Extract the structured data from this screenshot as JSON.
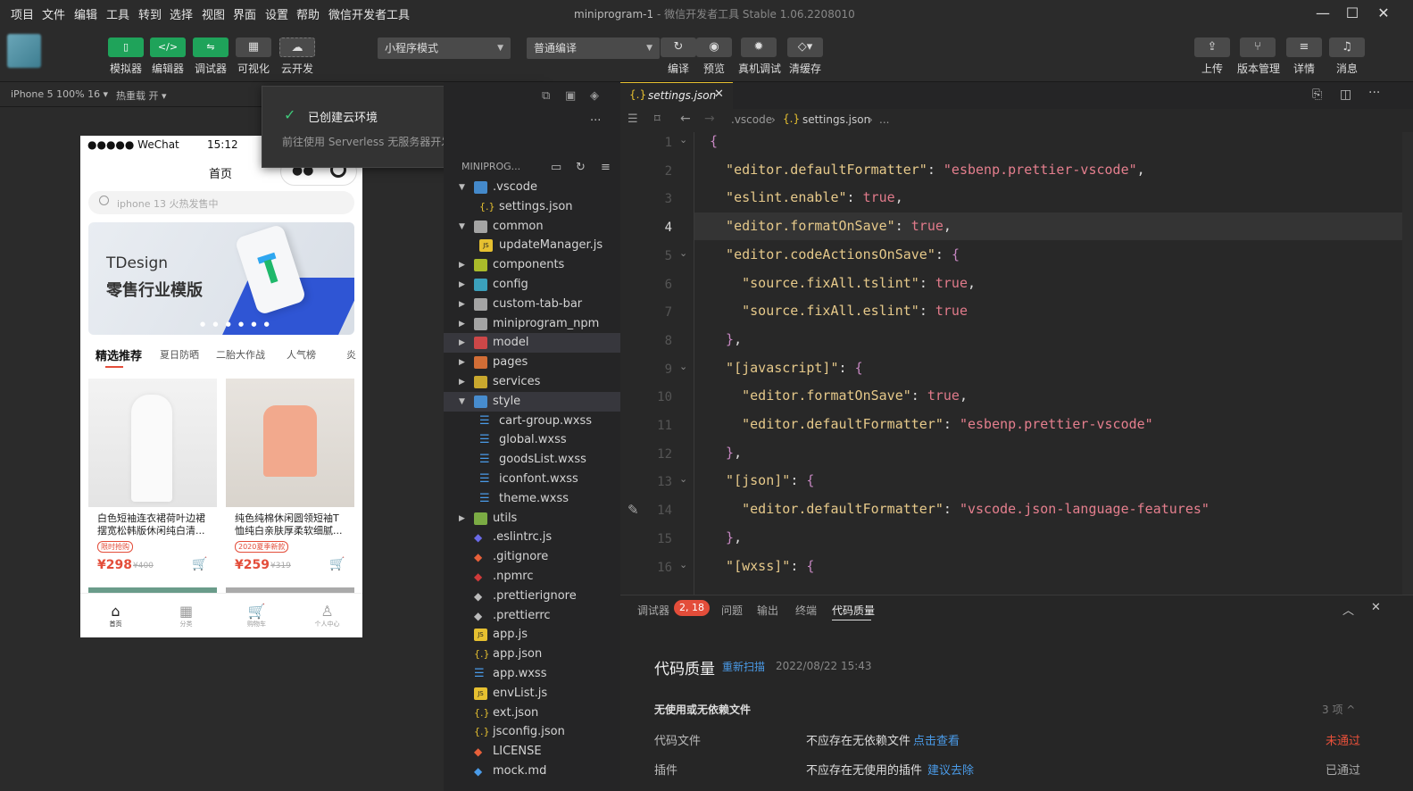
{
  "menubar": {
    "items": [
      "项目",
      "文件",
      "编辑",
      "工具",
      "转到",
      "选择",
      "视图",
      "界面",
      "设置",
      "帮助",
      "微信开发者工具"
    ],
    "title": "miniprogram-1",
    "title_sub": " - 微信开发者工具 Stable 1.06.2208010"
  },
  "toolbar": {
    "left_buttons": [
      {
        "label": "模拟器",
        "icon": "phone-icon"
      },
      {
        "label": "编辑器",
        "icon": "code-icon"
      },
      {
        "label": "调试器",
        "icon": "debug-icon"
      },
      {
        "label": "可视化",
        "icon": "layout-icon"
      },
      {
        "label": "云开发",
        "icon": "cloud-icon"
      }
    ],
    "mode_select": "小程序模式",
    "compile_select": "普通编译",
    "mid_buttons": [
      {
        "label": "编译",
        "icon": "refresh-icon"
      },
      {
        "label": "预览",
        "icon": "eye-icon"
      },
      {
        "label": "真机调试",
        "icon": "bug-icon"
      },
      {
        "label": "清缓存",
        "icon": "layers-icon"
      }
    ],
    "right_buttons": [
      {
        "label": "上传",
        "icon": "upload-icon"
      },
      {
        "label": "版本管理",
        "icon": "branch-icon"
      },
      {
        "label": "详情",
        "icon": "menu-icon"
      },
      {
        "label": "消息",
        "icon": "bell-icon"
      }
    ]
  },
  "simulator": {
    "device": "iPhone 5 100% 16 ▾",
    "hot_reload": "热重载 开 ▾",
    "status_carrier": "●●●●● WeChat",
    "status_time": "15:12",
    "page_title": "首页",
    "search_placeholder": "iphone 13 火热发售中",
    "banner_title": "TDesign",
    "banner_subtitle": "零售行业模版",
    "cat_tabs": [
      "精选推荐",
      "夏日防晒",
      "二胎大作战",
      "人气榜",
      "炎"
    ],
    "products": [
      {
        "title": "白色短袖连衣裙荷叶边裙摆宽松韩版休闲纯白清...",
        "tag": "限时抢购",
        "price": "¥298",
        "orig": "¥400"
      },
      {
        "title": "纯色纯棉休闲圆领短袖T恤纯白亲肤厚柔软细腻...",
        "tag": "2020夏季新款",
        "price": "¥259",
        "orig": "¥319"
      }
    ],
    "tabbar": [
      "首页",
      "分类",
      "购物车",
      "个人中心"
    ]
  },
  "toast": {
    "title": "已创建云环境",
    "desc": "前往使用 Serverless 无服务器开发模式。"
  },
  "explorer": {
    "root": "MINIPROG...",
    "files": [
      {
        "name": ".vscode",
        "type": "folder",
        "color": "#4a9be8",
        "depth": 0,
        "open": true
      },
      {
        "name": "settings.json",
        "type": "json",
        "color": "#e6c030",
        "depth": 1
      },
      {
        "name": "common",
        "type": "folder",
        "color": "#bbbbbb",
        "depth": 0,
        "open": true
      },
      {
        "name": "updateManager.js",
        "type": "js",
        "color": "#e6c030",
        "depth": 1
      },
      {
        "name": "components",
        "type": "folder",
        "color": "#c2d62b",
        "depth": 0
      },
      {
        "name": "config",
        "type": "folder",
        "color": "#3fb6d6",
        "depth": 0
      },
      {
        "name": "custom-tab-bar",
        "type": "folder",
        "color": "#bbbbbb",
        "depth": 0
      },
      {
        "name": "miniprogram_npm",
        "type": "folder",
        "color": "#bbbbbb",
        "depth": 0
      },
      {
        "name": "model",
        "type": "folder",
        "color": "#e84a4a",
        "depth": 0,
        "selected": true
      },
      {
        "name": "pages",
        "type": "folder",
        "color": "#f07a3a",
        "depth": 0
      },
      {
        "name": "services",
        "type": "folder",
        "color": "#e6c030",
        "depth": 0
      },
      {
        "name": "style",
        "type": "folder",
        "color": "#4a9be8",
        "depth": 0,
        "open": true,
        "selected": true
      },
      {
        "name": "cart-group.wxss",
        "type": "css",
        "color": "#4a9be8",
        "depth": 1
      },
      {
        "name": "global.wxss",
        "type": "css",
        "color": "#4a9be8",
        "depth": 1
      },
      {
        "name": "goodsList.wxss",
        "type": "css",
        "color": "#4a9be8",
        "depth": 1
      },
      {
        "name": "iconfont.wxss",
        "type": "css",
        "color": "#4a9be8",
        "depth": 1
      },
      {
        "name": "theme.wxss",
        "type": "css",
        "color": "#4a9be8",
        "depth": 1
      },
      {
        "name": "utils",
        "type": "folder",
        "color": "#8bc34a",
        "depth": 0
      },
      {
        "name": ".eslintrc.js",
        "type": "file",
        "color": "#6a6ae8",
        "depth": 0
      },
      {
        "name": ".gitignore",
        "type": "file",
        "color": "#e8603a",
        "depth": 0
      },
      {
        "name": ".npmrc",
        "type": "file",
        "color": "#d03a3a",
        "depth": 0
      },
      {
        "name": ".prettierignore",
        "type": "file",
        "color": "#bbbbbb",
        "depth": 0
      },
      {
        "name": ".prettierrc",
        "type": "file",
        "color": "#bbbbbb",
        "depth": 0
      },
      {
        "name": "app.js",
        "type": "js",
        "color": "#e6c030",
        "depth": 0
      },
      {
        "name": "app.json",
        "type": "json",
        "color": "#e6c030",
        "depth": 0
      },
      {
        "name": "app.wxss",
        "type": "css",
        "color": "#4a9be8",
        "depth": 0
      },
      {
        "name": "envList.js",
        "type": "js",
        "color": "#e6c030",
        "depth": 0
      },
      {
        "name": "ext.json",
        "type": "json",
        "color": "#e6c030",
        "depth": 0
      },
      {
        "name": "jsconfig.json",
        "type": "json",
        "color": "#e6c030",
        "depth": 0
      },
      {
        "name": "LICENSE",
        "type": "file",
        "color": "#e8603a",
        "depth": 0
      },
      {
        "name": "mock.md",
        "type": "file",
        "color": "#4a9be8",
        "depth": 0
      }
    ]
  },
  "editor": {
    "tab": "settings.json",
    "breadcrumb": [
      ".vscode",
      "settings.json",
      "..."
    ],
    "lines": [
      {
        "n": "1",
        "t": [
          [
            "pn",
            "{"
          ]
        ]
      },
      {
        "n": "2",
        "t": [
          [
            "k",
            "  \"editor.defaultFormatter\""
          ],
          [
            "d",
            ": "
          ],
          [
            "s",
            "\"esbenp.prettier-vscode\""
          ],
          [
            "d",
            ","
          ]
        ]
      },
      {
        "n": "3",
        "t": [
          [
            "k",
            "  \"eslint.enable\""
          ],
          [
            "d",
            ": "
          ],
          [
            "b",
            "true"
          ],
          [
            "d",
            ","
          ]
        ]
      },
      {
        "n": "4",
        "t": [
          [
            "k",
            "  \"editor.formatOnSave\""
          ],
          [
            "d",
            ": "
          ],
          [
            "b",
            "true"
          ],
          [
            "d",
            ","
          ]
        ]
      },
      {
        "n": "5",
        "t": [
          [
            "k",
            "  \"editor.codeActionsOnSave\""
          ],
          [
            "d",
            ": "
          ],
          [
            "pn",
            "{"
          ]
        ]
      },
      {
        "n": "6",
        "t": [
          [
            "k",
            "    \"source.fixAll.tslint\""
          ],
          [
            "d",
            ": "
          ],
          [
            "b",
            "true"
          ],
          [
            "d",
            ","
          ]
        ]
      },
      {
        "n": "7",
        "t": [
          [
            "k",
            "    \"source.fixAll.eslint\""
          ],
          [
            "d",
            ": "
          ],
          [
            "b",
            "true"
          ]
        ]
      },
      {
        "n": "8",
        "t": [
          [
            "pn",
            "  }"
          ],
          [
            "d",
            ","
          ]
        ]
      },
      {
        "n": "9",
        "t": [
          [
            "k",
            "  \"[javascript]\""
          ],
          [
            "d",
            ": "
          ],
          [
            "pn",
            "{"
          ]
        ]
      },
      {
        "n": "10",
        "t": [
          [
            "k",
            "    \"editor.formatOnSave\""
          ],
          [
            "d",
            ": "
          ],
          [
            "b",
            "true"
          ],
          [
            "d",
            ","
          ]
        ]
      },
      {
        "n": "11",
        "t": [
          [
            "k",
            "    \"editor.defaultFormatter\""
          ],
          [
            "d",
            ": "
          ],
          [
            "s",
            "\"esbenp.prettier-vscode\""
          ]
        ]
      },
      {
        "n": "12",
        "t": [
          [
            "pn",
            "  }"
          ],
          [
            "d",
            ","
          ]
        ]
      },
      {
        "n": "13",
        "t": [
          [
            "k",
            "  \"[json]\""
          ],
          [
            "d",
            ": "
          ],
          [
            "pn",
            "{"
          ]
        ]
      },
      {
        "n": "14",
        "t": [
          [
            "k",
            "    \"editor.defaultFormatter\""
          ],
          [
            "d",
            ": "
          ],
          [
            "s",
            "\"vscode.json-language-features\""
          ]
        ]
      },
      {
        "n": "15",
        "t": [
          [
            "pn",
            "  }"
          ],
          [
            "d",
            ","
          ]
        ]
      },
      {
        "n": "16",
        "t": [
          [
            "k",
            "  \"[wxss]\""
          ],
          [
            "d",
            ": "
          ],
          [
            "pn",
            "{"
          ]
        ]
      }
    ]
  },
  "panel": {
    "tabs": [
      "调试器",
      "问题",
      "输出",
      "终端",
      "代码质量"
    ],
    "debug_badge": "2, 18",
    "title": "代码质量",
    "rescan": "重新扫描",
    "date": "2022/08/22 15:43",
    "section": "无使用或无依赖文件",
    "count": "3 项 ^",
    "rows": [
      {
        "label": "代码文件",
        "desc": "不应存在无依赖文件",
        "link": "点击查看",
        "status": "未通过",
        "status_color": "#e8503a"
      },
      {
        "label": "插件",
        "desc": "不应存在无使用的插件",
        "link": "建议去除",
        "status": "已通过",
        "status_color": "#aaaaaa"
      }
    ]
  }
}
